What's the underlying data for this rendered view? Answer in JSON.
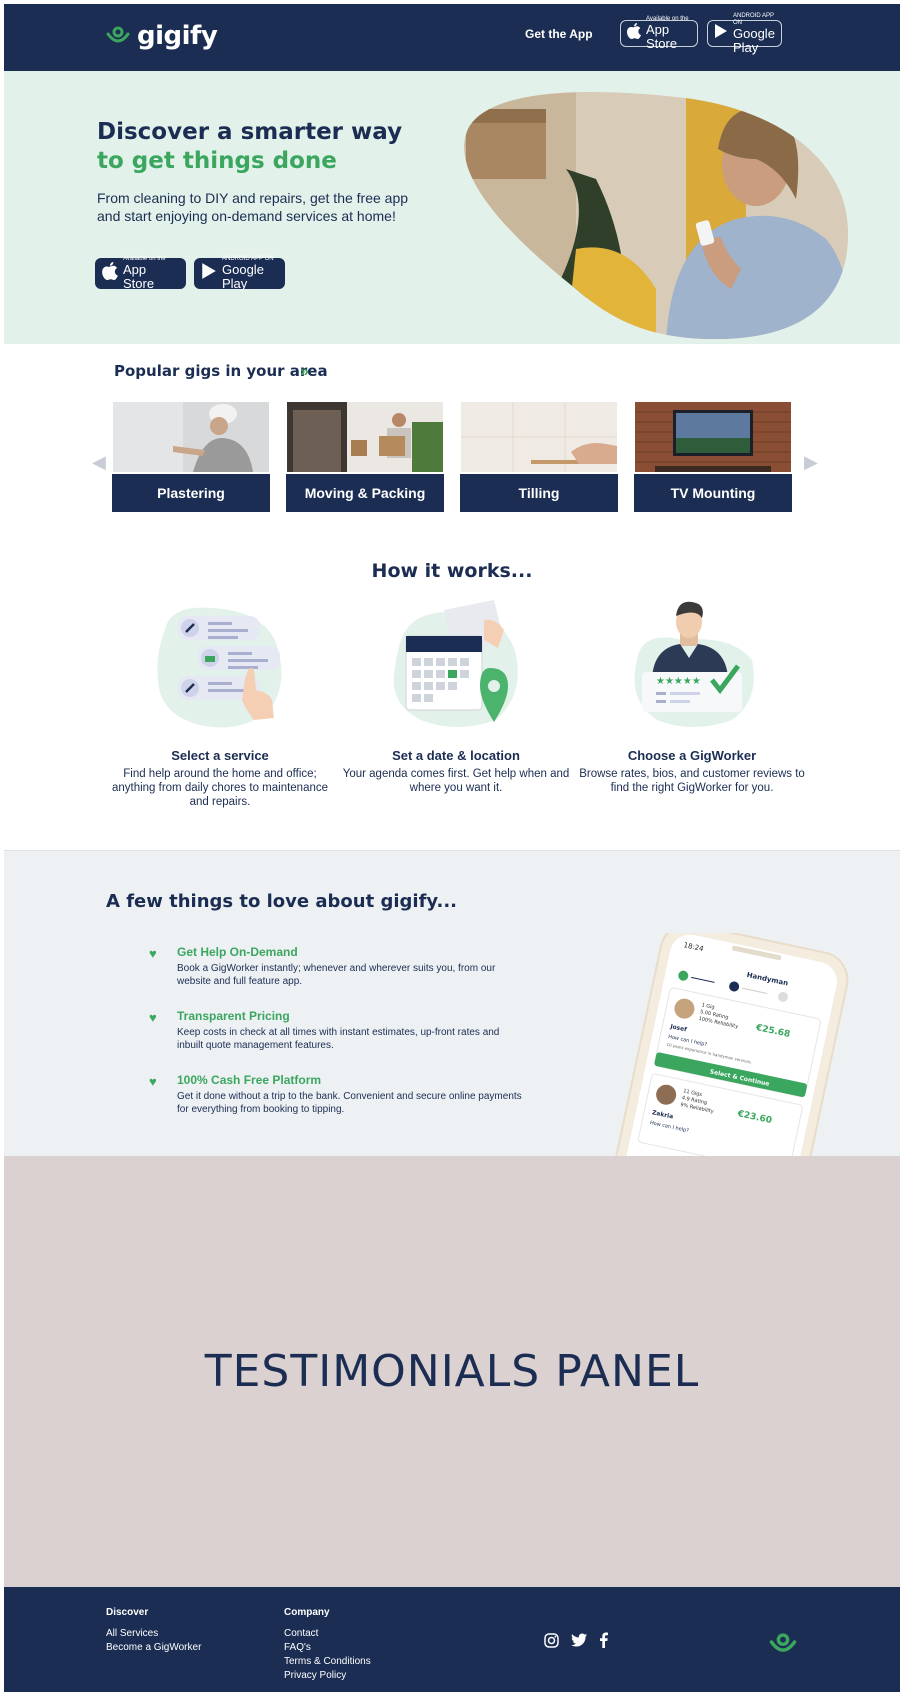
{
  "header": {
    "logo_text": "gigify",
    "get_app_label": "Get the App",
    "app_store": {
      "small": "Available on the",
      "big": "App Store"
    },
    "google_play": {
      "small": "ANDROID APP ON",
      "big": "Google Play"
    }
  },
  "hero": {
    "title_line1": "Discover a smarter way",
    "title_line2": "to get things done",
    "subtitle": "From cleaning to DIY and repairs, get the free app and start enjoying on-demand services at home!",
    "app_store": {
      "small": "Available on the",
      "big": "App Store"
    },
    "google_play": {
      "small": "ANDROID APP ON",
      "big": "Google Play"
    }
  },
  "popular": {
    "title": "Popular gigs in your area",
    "arrow": "»",
    "prev": "◀",
    "next": "▶",
    "gigs": [
      {
        "label": "Plastering"
      },
      {
        "label": "Moving & Packing"
      },
      {
        "label": "Tilling"
      },
      {
        "label": "TV Mounting"
      }
    ]
  },
  "how": {
    "title": "How it works...",
    "steps": [
      {
        "title": "Select a service",
        "desc": "Find help around the home and office; anything from daily chores to maintenance and repairs."
      },
      {
        "title": "Set a date & location",
        "desc": "Your agenda comes first. Get help when and where you want it."
      },
      {
        "title": "Choose a GigWorker",
        "desc": "Browse rates, bios, and customer reviews to find the right GigWorker for you."
      }
    ]
  },
  "love": {
    "title": "A few things to love about gigify...",
    "features": [
      {
        "title": "Get Help On-Demand",
        "desc": "Book a GigWorker instantly; whenever and wherever suits you, from our website and full feature app."
      },
      {
        "title": "Transparent Pricing",
        "desc": "Keep costs in check at all times with instant estimates, up-front rates and inbuilt quote management features."
      },
      {
        "title": "100% Cash Free Platform",
        "desc": "Get it done without a trip to the bank. Convenient and secure online payments for everything from booking to tipping."
      }
    ],
    "phone": {
      "time": "18:24",
      "header": "Handyman",
      "worker1": {
        "name": "Josef",
        "price": "€25.68",
        "gigs": "1 Gig",
        "rating": "5.00 Rating",
        "reliability": "100% Reliability",
        "question": "How can I help?",
        "answer": "10 years experience in handyman services."
      },
      "cta": "Select & Continue",
      "worker2": {
        "name": "Zakria",
        "price": "€23.60",
        "gigs": "11 Gigs",
        "rating": "4.9 Rating",
        "reliability": "9% Reliability",
        "question": "How can I help?"
      }
    }
  },
  "testimonials": {
    "text": "TESTIMONIALS PANEL"
  },
  "footer": {
    "discover": {
      "heading": "Discover",
      "links": [
        "All Services",
        "Become a GigWorker"
      ]
    },
    "company": {
      "heading": "Company",
      "links": [
        "Contact",
        "FAQ's",
        "Terms & Conditions",
        "Privacy Policy"
      ]
    }
  },
  "colors": {
    "navy": "#1b2d52",
    "green": "#3aa65e",
    "mint": "#e2f1ea",
    "testimonial_bg": "#dad1d0"
  }
}
